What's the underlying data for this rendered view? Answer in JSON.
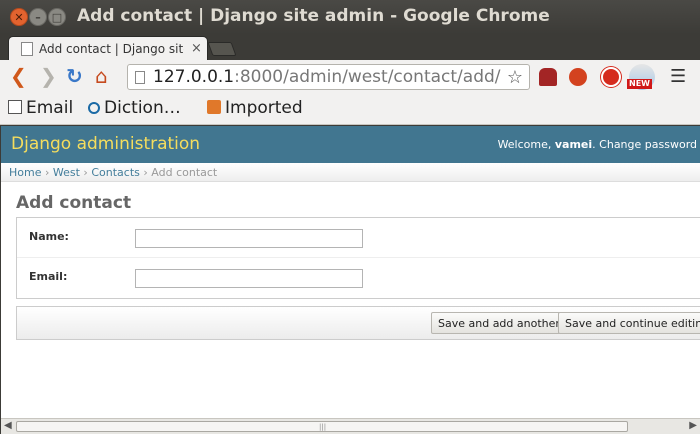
{
  "window": {
    "title": "Add contact | Django site admin - Google Chrome",
    "close_glyph": "✕",
    "min_glyph": "–",
    "max_glyph": "□"
  },
  "tab": {
    "label": "Add contact | Django site",
    "close_glyph": "×"
  },
  "toolbar": {
    "back_glyph": "❮",
    "forward_glyph": "❯",
    "reload_glyph": "↻",
    "home_glyph": "⌂",
    "url_host": "127.0.0.1",
    "url_rest": ":8000/admin/west/contact/add/",
    "star_glyph": "☆",
    "menu_glyph": "☰",
    "ext_badge": "NEW"
  },
  "bookmarks": [
    {
      "label": "Email"
    },
    {
      "label": "Diction…"
    },
    {
      "label": "Imported"
    }
  ],
  "django": {
    "brand": "Django administration",
    "welcome": "Welcome, ",
    "user": "vamei",
    "welcome_suffix": ". Change password",
    "header_color": "#417690",
    "brand_color": "#f5dd5d"
  },
  "breadcrumbs": {
    "home": "Home",
    "app": "West",
    "model": "Contacts",
    "current": "Add contact",
    "sep": " › "
  },
  "content": {
    "title": "Add contact"
  },
  "form": {
    "fields": [
      {
        "label": "Name:",
        "value": ""
      },
      {
        "label": "Email:",
        "value": ""
      }
    ],
    "buttons": {
      "save_add_another": "Save and add another",
      "save_continue": "Save and continue editing"
    }
  },
  "scrollbar": {
    "left_glyph": "◀",
    "right_glyph": "▶",
    "grip_glyph": "|||"
  }
}
